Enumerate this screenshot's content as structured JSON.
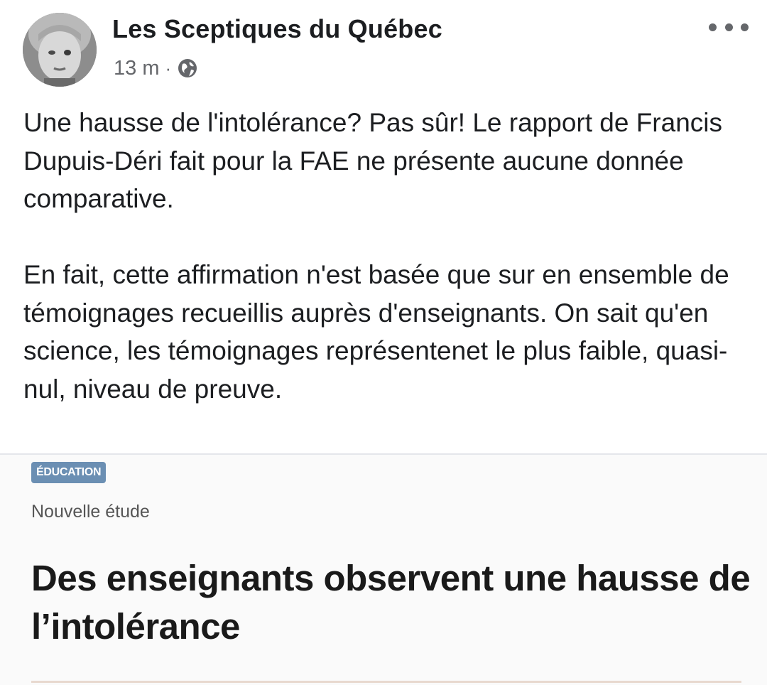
{
  "post": {
    "author": "Les Sceptiques du Québec",
    "time": "13 m",
    "separator": "·",
    "visibility_icon": "globe-icon",
    "more_icon": "more-horizontal-icon",
    "paragraph_1": "Une hausse de l'intolérance? Pas sûr! Le rapport de Francis Dupuis-Déri fait pour la FAE ne présente aucune donnée comparative.",
    "paragraph_2": "En fait, cette affirmation n'est basée que sur en ensemble de témoignages recueillis auprès d'enseignants. On sait qu'en science, les témoignages représentenet le plus faible, quasi-nul, niveau de preuve."
  },
  "link_preview": {
    "badge": "ÉDUCATION",
    "badge_color": "#6b8fb3",
    "kicker": "Nouvelle étude",
    "headline": "Des enseignants observent une hausse de l’intolérance"
  }
}
